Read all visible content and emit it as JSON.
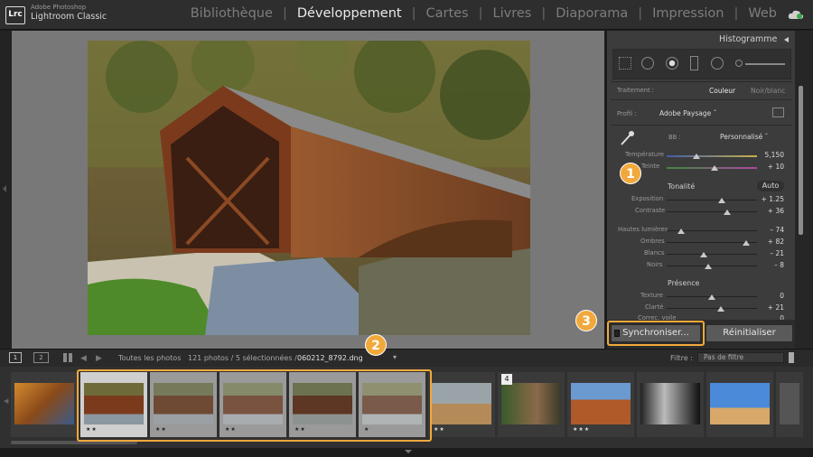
{
  "app": {
    "brand_top": "Adobe Photoshop",
    "brand_main": "Lightroom Classic",
    "logo": "Lrc"
  },
  "modules": [
    {
      "label": "Bibliothèque",
      "active": false
    },
    {
      "label": "Développement",
      "active": true
    },
    {
      "label": "Cartes",
      "active": false
    },
    {
      "label": "Livres",
      "active": false
    },
    {
      "label": "Diaporama",
      "active": false
    },
    {
      "label": "Impression",
      "active": false
    },
    {
      "label": "Web",
      "active": false
    }
  ],
  "panel": {
    "histogram_title": "Histogramme",
    "treatment_label": "Traitement :",
    "treatment_color": "Couleur",
    "treatment_bw": "Noir/blanc",
    "profile_label": "Profil :",
    "profile_value": "Adobe Paysage",
    "wb_label": "BB :",
    "wb_value": "Personnalisé",
    "temperature_label": "Température",
    "temperature_value": "5,150",
    "tint_label": "Teinte",
    "tint_value": "+ 10",
    "tone_label": "Tonalité",
    "auto_label": "Auto",
    "exposure_label": "Exposition",
    "exposure_value": "+ 1.25",
    "contrast_label": "Contraste",
    "contrast_value": "+ 36",
    "highlights_label": "Hautes lumières",
    "highlights_value": "– 74",
    "shadows_label": "Ombres",
    "shadows_value": "+ 82",
    "whites_label": "Blancs",
    "whites_value": "– 21",
    "blacks_label": "Noirs",
    "blacks_value": "– 8",
    "presence_label": "Présence",
    "texture_label": "Texture",
    "texture_value": "0",
    "clarity_label": "Clarté",
    "clarity_value": "+ 21",
    "vibrance_label": "Correc. voile",
    "vibrance_value": "0"
  },
  "buttons": {
    "sync": "Synchroniser...",
    "reset": "Réinitialiser"
  },
  "filmstrip_bar": {
    "view1": "1",
    "view2": "2",
    "source": "Toutes les photos",
    "count": "121 photos / 5 sélectionnées /",
    "filename": "060212_8792.dng",
    "filter_label": "Filtre :",
    "filter_value": "Pas de filtre"
  },
  "filmstrip": {
    "stack_count": "4",
    "stars": [
      "",
      "★★",
      "★★",
      "★★",
      "★★",
      "★",
      "★★",
      "",
      "",
      "★★★",
      "",
      "",
      ""
    ]
  },
  "badges": [
    "1",
    "2",
    "3"
  ],
  "colors": {
    "highlight": "#f2a93b",
    "accent_text": "#eaeaea",
    "panel_bg": "#3c3c3c"
  },
  "icons": [
    "cloud-sync-icon",
    "eyedropper-icon",
    "grid-icon",
    "arrow-left-icon",
    "arrow-right-icon",
    "panel-collapse-icon",
    "profile-browser-icon"
  ]
}
